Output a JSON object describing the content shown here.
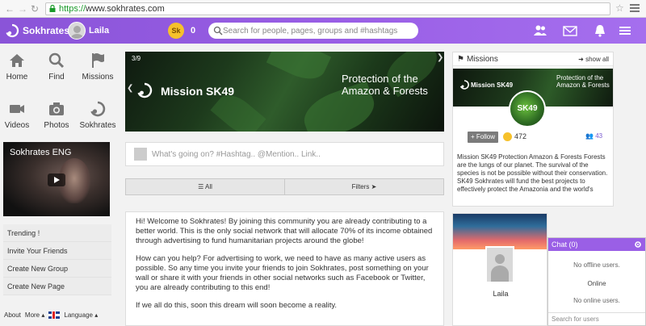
{
  "browser": {
    "url_scheme": "https://",
    "url_host": "www.sokhrates.com"
  },
  "header": {
    "brand": "Sokhrates",
    "user_name": "Laila",
    "coin_label": "Sk",
    "coin_count": "0",
    "search_placeholder": "Search for people, pages, groups and #hashtags"
  },
  "sidebar": {
    "quick_links": [
      "Home",
      "Find",
      "Missions",
      "Videos",
      "Photos",
      "Sokhrates"
    ],
    "video_title": "Sokhrates ENG",
    "menu": [
      "Trending !",
      "Invite Your Friends",
      "Create New Group",
      "Create New Page"
    ],
    "footer": {
      "about": "About",
      "more": "More ▴",
      "language": "Language ▴"
    }
  },
  "feed": {
    "banner": {
      "counter": "3/9",
      "title": "Mission SK49",
      "description": "Protection of the Amazon & Forests"
    },
    "post_placeholder": "What's going on? #Hashtag.. @Mention.. Link..",
    "filters": {
      "all": "All",
      "filters": "Filters"
    },
    "welcome_paragraphs": [
      "Hi! Welcome to Sokhrates!   By joining this community you are already contributing to a better world. This is the only social network that will allocate 70% of its income obtained through advertising to fund humanitarian projects around the globe!",
      "How can you help? For advertising to work, we need to have as many active users as possible. So any time you invite your friends to join Sokhrates, post something on your wall or share it with your friends in other social networks such as Facebook or Twitter, you are already contributing to this end!",
      "If we all do this, soon this dream will soon become a reality."
    ]
  },
  "missions": {
    "title": "Missions",
    "show_all": "show all",
    "card_title": "Mission SK49",
    "card_desc": "Protection of the Amazon & Forests",
    "badge": "SK49",
    "follow_label": "+ Follow",
    "follow_count": "472",
    "members_count": "43",
    "text": "Mission SK49 Protection Amazon & Forests Forests are the lungs of our planet. The survival of the species is not be possible without their conservation. SK49 Sokhrates will fund the best projects to effectively protect the Amazonia and the world's"
  },
  "profile": {
    "name": "Laila"
  },
  "chat": {
    "title": "Chat (0)",
    "offline": "No offline users.",
    "online_label": "Online",
    "online": "No online users.",
    "search_placeholder": "Search for users"
  },
  "colors": {
    "brand": "#9a5fe6",
    "coin": "#f6c12b"
  }
}
